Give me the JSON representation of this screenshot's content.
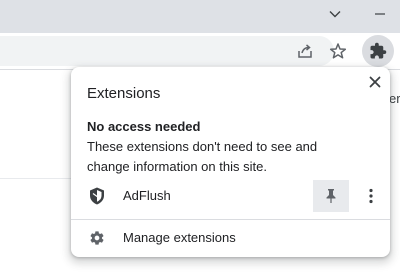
{
  "background": {
    "partial_text": "er"
  },
  "popup": {
    "title": "Extensions",
    "section_heading": "No access needed",
    "section_description": "These extensions don't need to see and change information on this site.",
    "extensions": [
      {
        "name": "AdFlush",
        "icon": "adflush-shield-icon"
      }
    ],
    "manage_label": "Manage extensions"
  },
  "icons": {
    "window": [
      "chevron-down-icon",
      "minimize-icon"
    ],
    "toolbar": [
      "share-icon",
      "bookmark-star-icon",
      "extensions-puzzle-icon"
    ],
    "popup": [
      "close-icon",
      "pin-icon",
      "more-vert-icon",
      "gear-icon"
    ]
  },
  "colors": {
    "titlebar": "#dee1e6",
    "omnibox": "#f1f3f4",
    "active_button": "#dadce0",
    "pin_highlight": "#e8eaed",
    "icon": "#5f6368",
    "text": "#202124"
  }
}
